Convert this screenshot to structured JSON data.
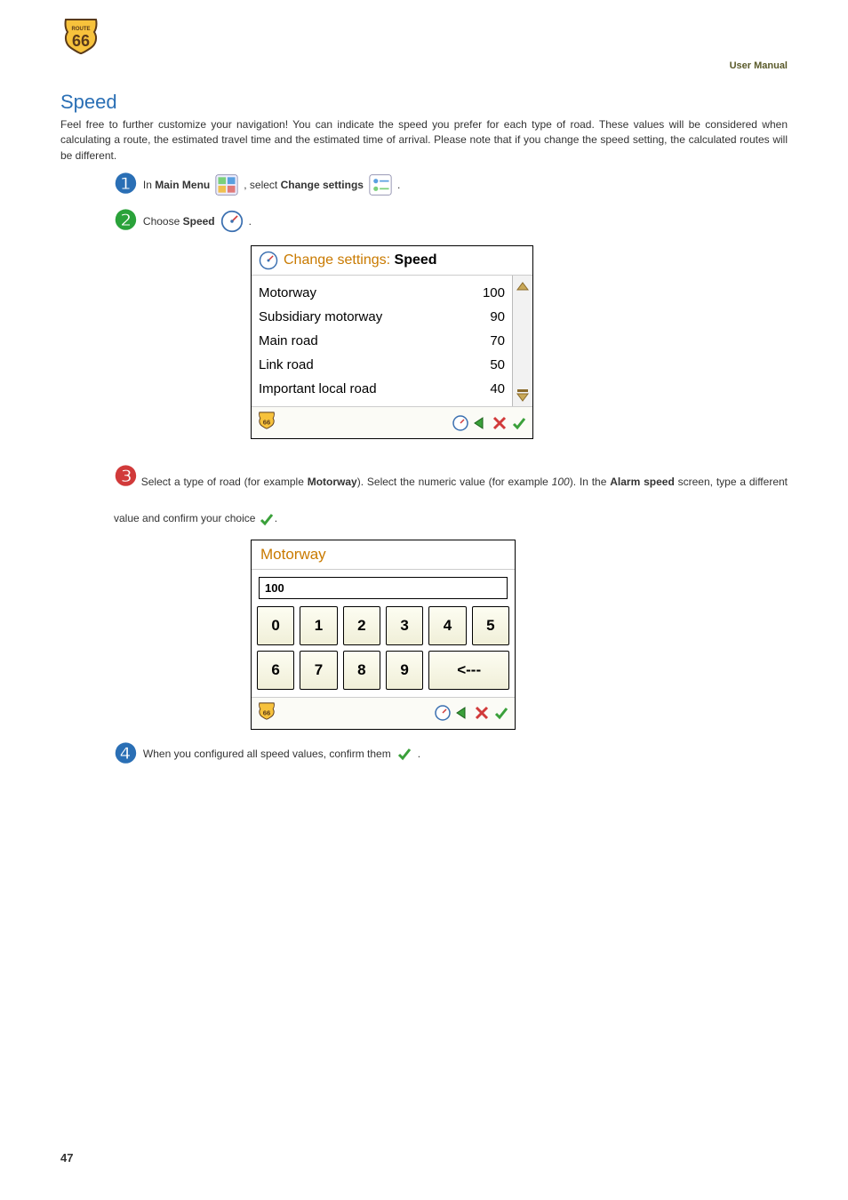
{
  "header": {
    "right": "User Manual"
  },
  "title": "Speed",
  "intro": "Feel free to further customize your navigation! You can indicate the speed you prefer for each type of road. These values will be considered when calculating a route, the estimated travel time and the estimated time of arrival. Please note that if you change the speed setting, the calculated routes will be different.",
  "steps": {
    "n1": "❶",
    "n2": "❷",
    "n3": "❸",
    "n4": "❹",
    "s1a": "In ",
    "s1b": "Main Menu",
    "s1c": " , select ",
    "s1d": "Change settings",
    "s1e": " .",
    "s2a": "Choose ",
    "s2b": "Speed",
    "s2c": " .",
    "s3a": "Select a type of road (for example ",
    "s3b": "Motorway",
    "s3c": "). Select the numeric value (for example ",
    "s3d": "100",
    "s3e": "). In the ",
    "s3f": "Alarm speed",
    "s3g": " screen, type a different value and confirm your choice ",
    "s3h": ".",
    "s4a": "When you configured all speed values, confirm them ",
    "s4b": "."
  },
  "panel1": {
    "title_prefix": "Change settings: ",
    "title_bold": "Speed",
    "rows": [
      {
        "label": "Motorway",
        "value": "100"
      },
      {
        "label": "Subsidiary motorway",
        "value": "90"
      },
      {
        "label": "Main road",
        "value": "70"
      },
      {
        "label": "Link road",
        "value": "50"
      },
      {
        "label": "Important local road",
        "value": "40"
      }
    ]
  },
  "panel2": {
    "title": "Motorway",
    "input": "100",
    "keys": [
      "0",
      "1",
      "2",
      "3",
      "4",
      "5",
      "6",
      "7",
      "8",
      "9"
    ],
    "backspace": "<---"
  },
  "page_number": "47"
}
